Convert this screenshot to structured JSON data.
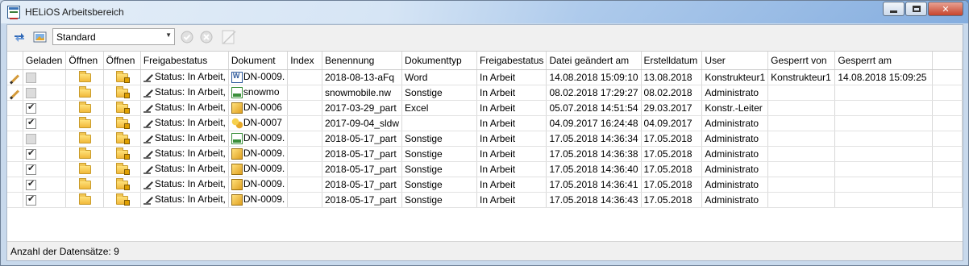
{
  "window": {
    "title": "HELiOS Arbeitsbereich"
  },
  "toolbar": {
    "view_select_value": "Standard"
  },
  "grid": {
    "headers": [
      "Geladen",
      "Öffnen",
      "Öffnen",
      "Freigabestatus",
      "Dokument",
      "Index",
      "Benennung",
      "Dokumenttyp",
      "Freigabestatus",
      "Datei geändert am",
      "Erstelldatum",
      "User",
      "Gesperrt von",
      "Gesperrt am"
    ],
    "rows": [
      {
        "edit": true,
        "loaded": "disabled",
        "status": "Status: In Arbeit,",
        "doc_icon": "word-document-icon",
        "document": "DN-0009.",
        "index": "",
        "name": "2018-08-13-aFq",
        "doctype": "Word",
        "release": "In Arbeit",
        "modified": "14.08.2018 15:09:10",
        "created": "13.08.2018",
        "user": "Konstrukteur1",
        "locked_by": "Konstrukteur1",
        "locked_at": "14.08.2018 15:09:25"
      },
      {
        "edit": true,
        "loaded": "disabled",
        "status": "Status: In Arbeit,",
        "doc_icon": "navisworks-file-icon",
        "document": "snowmo",
        "index": "",
        "name": "snowmobile.nw",
        "doctype": "Sonstige",
        "release": "In Arbeit",
        "modified": "08.02.2018 17:29:27",
        "created": "08.02.2018",
        "user": "Administrato",
        "locked_by": "",
        "locked_at": ""
      },
      {
        "edit": false,
        "loaded": "checked",
        "status": "Status: In Arbeit,",
        "doc_icon": "part-file-icon",
        "document": "DN-0006",
        "index": "",
        "name": "2017-03-29_part",
        "doctype": "Excel",
        "release": "In Arbeit",
        "modified": "05.07.2018 14:51:54",
        "created": "29.03.2017",
        "user": "Konstr.-Leiter",
        "locked_by": "",
        "locked_at": ""
      },
      {
        "edit": false,
        "loaded": "checked",
        "status": "Status: In Arbeit,",
        "doc_icon": "assembly-file-icon",
        "document": "DN-0007",
        "index": "",
        "name": "2017-09-04_sldw",
        "doctype": "",
        "release": "In Arbeit",
        "modified": "04.09.2017 16:24:48",
        "created": "04.09.2017",
        "user": "Administrato",
        "locked_by": "",
        "locked_at": ""
      },
      {
        "edit": false,
        "loaded": "disabled",
        "status": "Status: In Arbeit,",
        "doc_icon": "navisworks-file-icon",
        "document": "DN-0009.",
        "index": "",
        "name": "2018-05-17_part",
        "doctype": "Sonstige",
        "release": "In Arbeit",
        "modified": "17.05.2018 14:36:34",
        "created": "17.05.2018",
        "user": "Administrato",
        "locked_by": "",
        "locked_at": ""
      },
      {
        "edit": false,
        "loaded": "checked",
        "status": "Status: In Arbeit,",
        "doc_icon": "part-file-icon",
        "document": "DN-0009.",
        "index": "",
        "name": "2018-05-17_part",
        "doctype": "Sonstige",
        "release": "In Arbeit",
        "modified": "17.05.2018 14:36:38",
        "created": "17.05.2018",
        "user": "Administrato",
        "locked_by": "",
        "locked_at": ""
      },
      {
        "edit": false,
        "loaded": "checked",
        "status": "Status: In Arbeit,",
        "doc_icon": "part-file-icon",
        "document": "DN-0009.",
        "index": "",
        "name": "2018-05-17_part",
        "doctype": "Sonstige",
        "release": "In Arbeit",
        "modified": "17.05.2018 14:36:40",
        "created": "17.05.2018",
        "user": "Administrato",
        "locked_by": "",
        "locked_at": ""
      },
      {
        "edit": false,
        "loaded": "checked",
        "status": "Status: In Arbeit,",
        "doc_icon": "part-file-icon",
        "document": "DN-0009.",
        "index": "",
        "name": "2018-05-17_part",
        "doctype": "Sonstige",
        "release": "In Arbeit",
        "modified": "17.05.2018 14:36:41",
        "created": "17.05.2018",
        "user": "Administrato",
        "locked_by": "",
        "locked_at": ""
      },
      {
        "edit": false,
        "loaded": "checked",
        "status": "Status: In Arbeit,",
        "doc_icon": "part-file-icon",
        "document": "DN-0009.",
        "index": "",
        "name": "2018-05-17_part",
        "doctype": "Sonstige",
        "release": "In Arbeit",
        "modified": "17.05.2018 14:36:43",
        "created": "17.05.2018",
        "user": "Administrato",
        "locked_by": "",
        "locked_at": ""
      }
    ]
  },
  "statusbar": {
    "record_count": "Anzahl der Datensätze: 9"
  }
}
